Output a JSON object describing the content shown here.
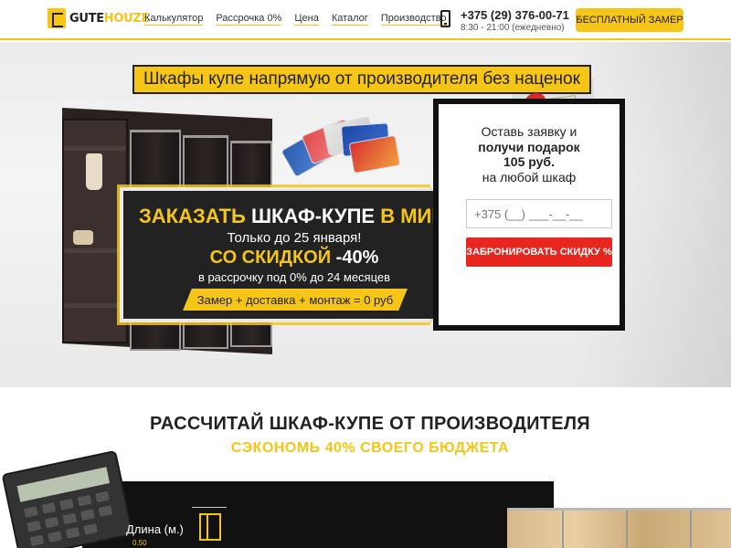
{
  "header": {
    "logo_a": "GUTE",
    "logo_b": "HOUZE",
    "nav": [
      "Калькулятор",
      "Рассрочка 0%",
      "Цена",
      "Каталог",
      "Производство"
    ],
    "phone": "+375 (29) 376-00-71",
    "hours": "8:30 - 21:00 (ежедневно)",
    "cta": "БЕСПЛАТНЫЙ ЗАМЕР"
  },
  "hero": {
    "title": "Шкафы купе напрямую от производителя без наценок",
    "promo": {
      "line1_yellow": "ЗАКАЗАТЬ ",
      "line1_white": "ШКАФ-КУПЕ",
      "line1_yellow2": " В МИНСКЕ!",
      "line2": "Только до 25 января!",
      "line3_yellow": "СО СКИДКОЙ ",
      "line3_white": "-40%",
      "line4": "в рассрочку под 0% до 24 месяцев",
      "tag": "Замер + доставка + монтаж = 0 руб"
    }
  },
  "form": {
    "line1": "Оставь заявку и",
    "line2": "получи подарок",
    "line2b": "105 руб.",
    "line3": "на любой шкаф",
    "phone_placeholder": "+375 (__) ___-__-__",
    "submit": "ЗАБРОНИРОВАТЬ СКИДКУ %"
  },
  "calc": {
    "title": "РАССЧИТАЙ ШКАФ-КУПЕ ОТ ПРОИЗВОДИТЕЛЯ",
    "subtitle": "СЭКОНОМЬ 40% СВОЕГО БЮДЖЕТА",
    "length_label": "Длина (м.)",
    "length_value": "0.50"
  },
  "colors": {
    "accent": "#f5c518",
    "dark": "#222222",
    "cta_red": "#e8251e"
  }
}
